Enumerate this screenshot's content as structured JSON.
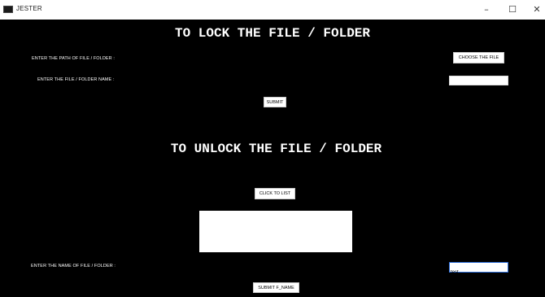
{
  "window": {
    "title": "JESTER",
    "minimize": "–",
    "maximize": "☐",
    "close": "✕"
  },
  "lock": {
    "heading": "TO LOCK THE FILE / FOLDER",
    "path_label": "ENTER THE PATH OF FILE / FOLDER :",
    "choose_button": "CHOOSE THE FILE",
    "name_label": "ENTER THE FILE / FOLDER NAME :",
    "name_value": "",
    "submit_button": "SUBMIT"
  },
  "unlock": {
    "heading": "TO UNLOCK THE FILE / FOLDER",
    "list_button": "CLICK TO LIST",
    "name_label": "ENTER THE NAME OF FILE / FOLDER :",
    "name_value": "test",
    "submit_button": "SUBMIT F_NAME"
  }
}
